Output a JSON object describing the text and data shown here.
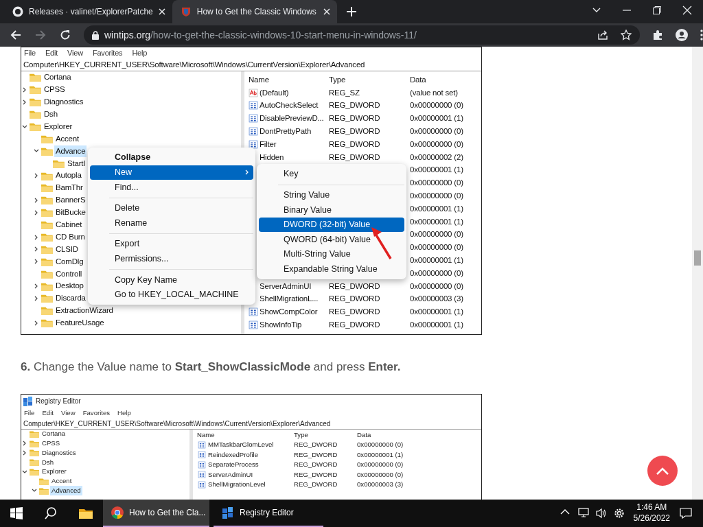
{
  "browser": {
    "tabs": [
      {
        "title": "Releases · valinet/ExplorerPatche",
        "selected": false
      },
      {
        "title": "How to Get the Classic Windows",
        "selected": true
      }
    ],
    "nav": [
      {
        "kind": "back",
        "disabled": false
      },
      {
        "kind": "forward",
        "disabled": true
      },
      {
        "kind": "reload",
        "disabled": false
      }
    ],
    "address": {
      "domain": "wintips.org",
      "path": "/how-to-get-the-classic-windows-10-start-menu-in-windows-11/"
    }
  },
  "article": {
    "figures": [
      {
        "menu": [
          "File",
          "Edit",
          "View",
          "Favorites",
          "Help"
        ],
        "path": "Computer\\HKEY_CURRENT_USER\\Software\\Microsoft\\Windows\\CurrentVersion\\Explorer\\Advanced",
        "tree": [
          {
            "label": "Cortana",
            "kind": "leaf",
            "selected": false
          },
          {
            "label": "CPSS",
            "kind": "branch",
            "expanded": false,
            "selected": false
          },
          {
            "label": "Diagnostics",
            "kind": "branch",
            "expanded": false,
            "selected": false
          },
          {
            "label": "Dsh",
            "kind": "leaf",
            "selected": false
          },
          {
            "label": "Explorer",
            "kind": "branch",
            "expanded": true,
            "selected": false,
            "children": [
              {
                "label": "Accent",
                "kind": "leaf",
                "selected": false
              },
              {
                "label": "Advance",
                "kind": "branch",
                "expanded": true,
                "selected": true,
                "children": [
                  {
                    "label": "StartI",
                    "kind": "leaf",
                    "selected": false
                  }
                ]
              },
              {
                "label": "Autopla",
                "kind": "branch",
                "expanded": false,
                "selected": false
              },
              {
                "label": "BamThr",
                "kind": "leaf",
                "selected": false
              },
              {
                "label": "BannerS",
                "kind": "branch",
                "expanded": false,
                "selected": false
              },
              {
                "label": "BitBucke",
                "kind": "branch",
                "expanded": false,
                "selected": false
              },
              {
                "label": "Cabinet",
                "kind": "leaf",
                "selected": false
              },
              {
                "label": "CD Burn",
                "kind": "branch",
                "expanded": false,
                "selected": false
              },
              {
                "label": "CLSID",
                "kind": "branch",
                "expanded": false,
                "selected": false
              },
              {
                "label": "ComDlg",
                "kind": "branch",
                "expanded": false,
                "selected": false
              },
              {
                "label": "Controll",
                "kind": "leaf",
                "selected": false
              },
              {
                "label": "Desktop",
                "kind": "branch",
                "expanded": false,
                "selected": false
              },
              {
                "label": "Discarda",
                "kind": "branch",
                "expanded": false,
                "selected": false
              },
              {
                "label": "ExtractionWizard",
                "kind": "leaf",
                "selected": false
              },
              {
                "label": "FeatureUsage",
                "kind": "branch",
                "expanded": false,
                "selected": false
              }
            ]
          }
        ],
        "columns": [
          "Name",
          "Type",
          "Data"
        ],
        "rows": [
          {
            "kind": "string",
            "name": "(Default)",
            "type": "REG_SZ",
            "data": "(value not set)"
          },
          {
            "kind": "dword",
            "name": "AutoCheckSelect",
            "type": "REG_DWORD",
            "data": "0x00000000 (0)"
          },
          {
            "kind": "dword",
            "name": "DisablePreviewD...",
            "type": "REG_DWORD",
            "data": "0x00000001 (1)"
          },
          {
            "kind": "dword",
            "name": "DontPrettyPath",
            "type": "REG_DWORD",
            "data": "0x00000000 (0)"
          },
          {
            "kind": "dword",
            "name": "Filter",
            "type": "REG_DWORD",
            "data": "0x00000000 (0)"
          },
          {
            "kind": "plain",
            "name": "Hidden",
            "type": "REG_DWORD",
            "data": "0x00000002 (2)"
          },
          {
            "kind": "plain",
            "data": "0x00000001 (1)"
          },
          {
            "kind": "plain",
            "data": "0x00000000 (0)"
          },
          {
            "kind": "plain",
            "data": "0x00000000 (0)"
          },
          {
            "kind": "plain",
            "data": "0x00000001 (1)"
          },
          {
            "kind": "plain",
            "data": "0x00000001 (1)"
          },
          {
            "kind": "plain",
            "data": "0x00000000 (0)"
          },
          {
            "kind": "plain",
            "data": "0x00000000 (0)"
          },
          {
            "kind": "plain",
            "data": "0x00000001 (1)"
          },
          {
            "kind": "plain",
            "data": "0x00000000 (0)"
          },
          {
            "kind": "plain",
            "name": "ServerAdminUI",
            "type": "REG_DWORD",
            "data": "0x00000000 (0)"
          },
          {
            "kind": "plain",
            "name": "ShellMigrationL...",
            "type": "REG_DWORD",
            "data": "0x00000003 (3)"
          },
          {
            "kind": "dword",
            "name": "ShowCompColor",
            "type": "REG_DWORD",
            "data": "0x00000001 (1)"
          },
          {
            "kind": "dword",
            "name": "ShowInfoTip",
            "type": "REG_DWORD",
            "data": "0x00000001 (1)"
          }
        ],
        "context_menu": [
          {
            "kind": "default",
            "label": "Collapse",
            "selected": false
          },
          {
            "kind": "submenu",
            "label": "New",
            "selected": true
          },
          {
            "kind": "item",
            "label": "Find...",
            "selected": false
          },
          {
            "kind": "separator"
          },
          {
            "kind": "item",
            "label": "Delete",
            "selected": false
          },
          {
            "kind": "item",
            "label": "Rename",
            "selected": false
          },
          {
            "kind": "separator"
          },
          {
            "kind": "item",
            "label": "Export",
            "selected": false
          },
          {
            "kind": "item",
            "label": "Permissions...",
            "selected": false
          },
          {
            "kind": "separator"
          },
          {
            "kind": "item",
            "label": "Copy Key Name",
            "selected": false
          },
          {
            "kind": "item",
            "label": "Go to HKEY_LOCAL_MACHINE",
            "selected": false
          }
        ],
        "submenu": [
          {
            "kind": "item",
            "label": "Key",
            "selected": false
          },
          {
            "kind": "separator"
          },
          {
            "kind": "item",
            "label": "String Value",
            "selected": false
          },
          {
            "kind": "item",
            "label": "Binary Value",
            "selected": false
          },
          {
            "kind": "item",
            "label": "DWORD (32-bit) Value",
            "selected": true
          },
          {
            "kind": "item",
            "label": "QWORD (64-bit) Value",
            "selected": false
          },
          {
            "kind": "item",
            "label": "Multi-String Value",
            "selected": false
          },
          {
            "kind": "item",
            "label": "Expandable String Value",
            "selected": false
          }
        ]
      },
      {
        "title": "Registry Editor",
        "menu": [
          "File",
          "Edit",
          "View",
          "Favorites",
          "Help"
        ],
        "path": "Computer\\HKEY_CURRENT_USER\\Software\\Microsoft\\Windows\\CurrentVersion\\Explorer\\Advanced",
        "tree": [
          {
            "label": "Cortana",
            "kind": "leaf",
            "selected": false
          },
          {
            "label": "CPSS",
            "kind": "branch",
            "expanded": false,
            "selected": false
          },
          {
            "label": "Diagnostics",
            "kind": "branch",
            "expanded": false,
            "selected": false
          },
          {
            "label": "Dsh",
            "kind": "leaf",
            "selected": false
          },
          {
            "label": "Explorer",
            "kind": "branch",
            "expanded": true,
            "selected": false,
            "children": [
              {
                "label": "Accent",
                "kind": "leaf",
                "selected": false
              },
              {
                "label": "Advanced",
                "kind": "branch",
                "expanded": true,
                "selected": true
              }
            ]
          }
        ],
        "columns": [
          "Name",
          "Type",
          "Data"
        ],
        "rows": [
          {
            "kind": "dword",
            "name": "MMTaskbarGlomLevel",
            "type": "REG_DWORD",
            "data": "0x00000000 (0)"
          },
          {
            "kind": "dword",
            "name": "ReindexedProfile",
            "type": "REG_DWORD",
            "data": "0x00000001 (1)"
          },
          {
            "kind": "dword",
            "name": "SeparateProcess",
            "type": "REG_DWORD",
            "data": "0x00000000 (0)"
          },
          {
            "kind": "dword",
            "name": "ServerAdminUI",
            "type": "REG_DWORD",
            "data": "0x00000000 (0)"
          },
          {
            "kind": "dword",
            "name": "ShellMigrationLevel",
            "type": "REG_DWORD",
            "data": "0x00000003 (3)"
          }
        ]
      }
    ],
    "step": "**6.** Change the Value name to **Start_ShowClassicMode** and press **Enter.**"
  },
  "taskbar": {
    "pinned": [
      {
        "kind": "start"
      },
      {
        "kind": "search"
      },
      {
        "kind": "folder"
      }
    ],
    "tasks": [
      {
        "label": "How to Get the Cla...",
        "selected": true
      },
      {
        "label": "Registry Editor",
        "selected": false
      }
    ],
    "time": "1:46 AM",
    "date": "5/26/2022"
  }
}
